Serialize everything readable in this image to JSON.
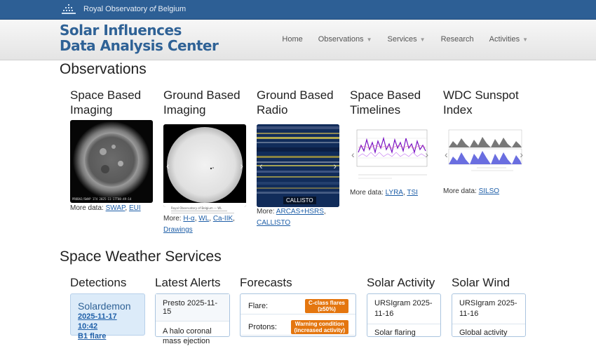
{
  "topbar": {
    "org_prefix": "Royal Observatory ",
    "org_of": "of",
    "org_suffix": " Belgium"
  },
  "brand": {
    "line1": "Solar Influences",
    "line2": "Data Analysis Center"
  },
  "nav": [
    {
      "label": "Home",
      "dropdown": false
    },
    {
      "label": "Observations",
      "dropdown": true
    },
    {
      "label": "Services",
      "dropdown": true
    },
    {
      "label": "Research",
      "dropdown": false
    },
    {
      "label": "Activities",
      "dropdown": true
    }
  ],
  "observations": {
    "title": "Observations",
    "columns": [
      {
        "title": "Space Based Imaging",
        "more_label": "More data:",
        "links": [
          "SWAP",
          "EUI"
        ],
        "thumb_caption": "PROBA2/SWAP 174  2025-11-17T08:49:14"
      },
      {
        "title": "Ground Based Imaging",
        "more_label": "More:",
        "links": [
          "H-α",
          "WL",
          "Ca-IIK",
          "Drawings"
        ],
        "thumb_caption": "Royal Observatory of Belgium — WL"
      },
      {
        "title": "Ground Based Radio",
        "more_label": "More:",
        "links": [
          "ARCAS+HSRS",
          "CALLISTO"
        ],
        "thumb_caption": "CALLISTO"
      },
      {
        "title": "Space Based Timelines",
        "more_label": "More data:",
        "links": [
          "LYRA",
          "TSI"
        ],
        "thumb_caption": ""
      },
      {
        "title": "WDC Sunspot Index",
        "more_label": "More data:",
        "links": [
          "SILSO"
        ],
        "thumb_caption": ""
      }
    ]
  },
  "services": {
    "title": "Space Weather Services",
    "detections": {
      "title": "Detections",
      "name": "Solardemon",
      "link1": "2025-11-17 10:42",
      "link2": "B1 flare"
    },
    "alerts": {
      "title": "Latest Alerts",
      "item_title": "Presto 2025-11-15",
      "item_text": "A halo coronal mass ejection"
    },
    "forecasts": {
      "title": "Forecasts",
      "rows": [
        {
          "label": "Flare:",
          "badge_l1": "C-class flares",
          "badge_l2": "(≥50%)"
        },
        {
          "label": "Protons:",
          "badge_l1": "Warning condition",
          "badge_l2": "(increased activity)"
        }
      ]
    },
    "solar_activity": {
      "title": "Solar Activity",
      "item_title": "URSIgram 2025-11-16",
      "item_text": "Solar flaring"
    },
    "solar_wind": {
      "title": "Solar Wind",
      "item_title": "URSIgram 2025-11-16",
      "item_text": "Global activity"
    }
  },
  "colors": {
    "topbar": "#2d5f95",
    "brand": "#2f6296",
    "badge": "#e4760f",
    "link": "#1f5fa8"
  }
}
